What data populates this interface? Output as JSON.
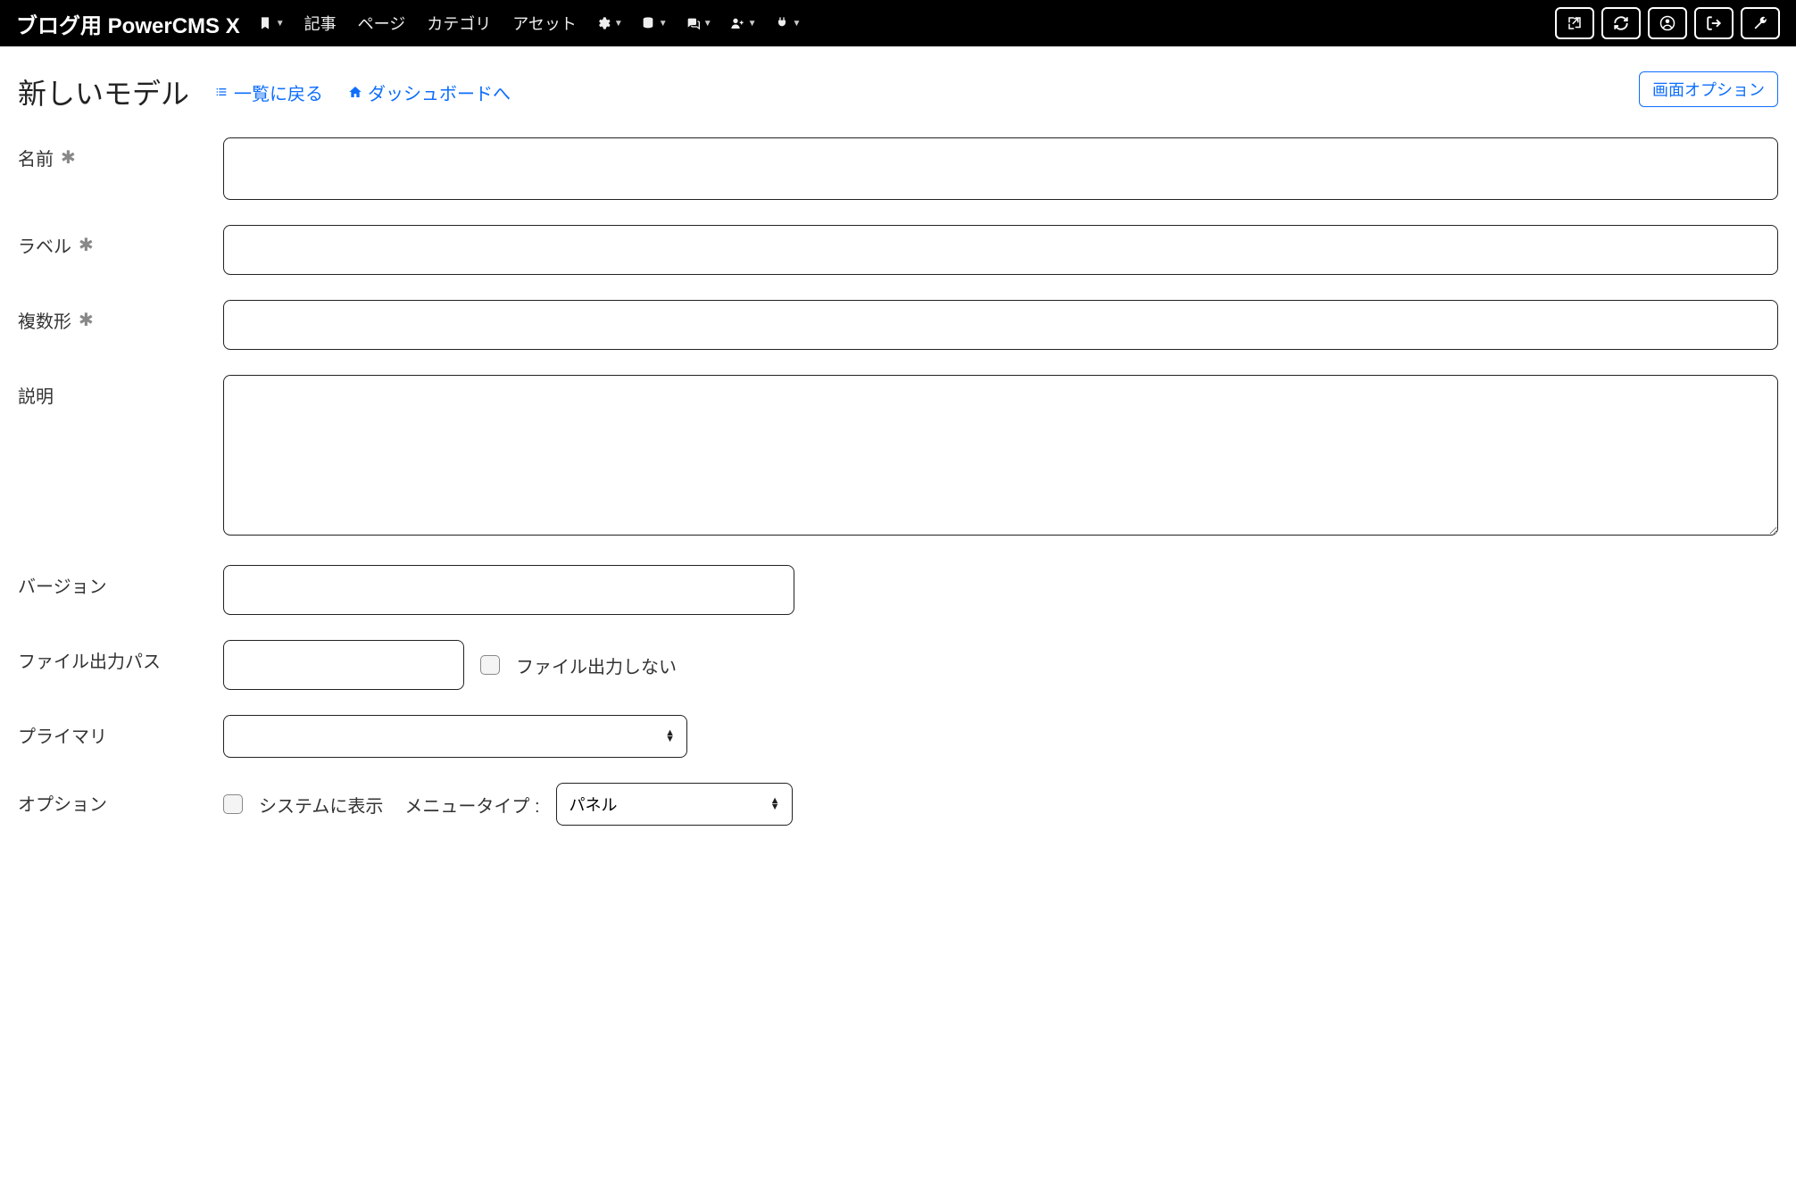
{
  "navbar": {
    "brand": "ブログ用 PowerCMS X",
    "items": [
      {
        "label": "記事"
      },
      {
        "label": "ページ"
      },
      {
        "label": "カテゴリ"
      },
      {
        "label": "アセット"
      }
    ]
  },
  "header": {
    "title": "新しいモデル",
    "back_link": "一覧に戻る",
    "dashboard_link": "ダッシュボードへ",
    "screen_options": "画面オプション"
  },
  "form": {
    "name": {
      "label": "名前",
      "value": ""
    },
    "label": {
      "label": "ラベル",
      "value": ""
    },
    "plural": {
      "label": "複数形",
      "value": ""
    },
    "description": {
      "label": "説明",
      "value": ""
    },
    "version": {
      "label": "バージョン",
      "value": ""
    },
    "output_path": {
      "label": "ファイル出力パス",
      "value": "",
      "no_output_label": "ファイル出力しない"
    },
    "primary": {
      "label": "プライマリ",
      "value": ""
    },
    "options": {
      "label": "オプション",
      "show_in_system_label": "システムに表示",
      "menu_type_label": "メニュータイプ :",
      "menu_type_value": "パネル"
    }
  }
}
